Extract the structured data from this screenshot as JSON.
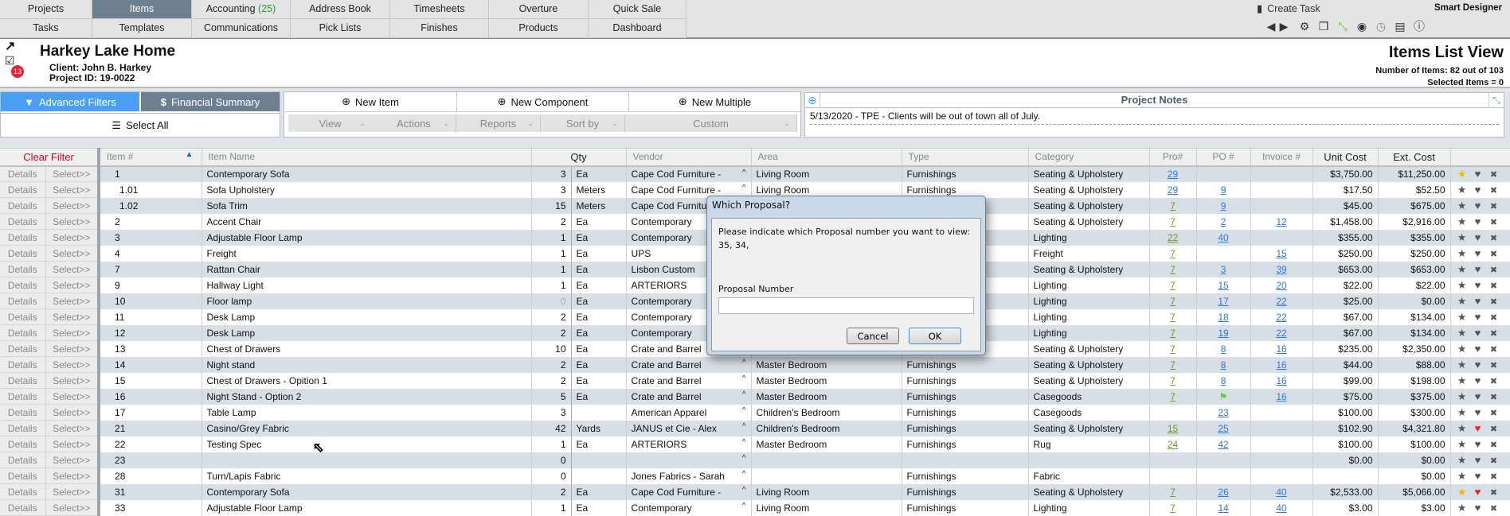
{
  "nav": {
    "row1": [
      {
        "label": "Projects"
      },
      {
        "label": "Items",
        "active": true
      },
      {
        "label": "Accounting",
        "count": "(25)"
      },
      {
        "label": "Address Book"
      },
      {
        "label": "Timesheets"
      },
      {
        "label": "Overture"
      },
      {
        "label": "Quick Sale"
      }
    ],
    "row2": [
      {
        "label": "Tasks"
      },
      {
        "label": "Templates"
      },
      {
        "label": "Communications"
      },
      {
        "label": "Pick Lists"
      },
      {
        "label": "Finishes"
      },
      {
        "label": "Products"
      },
      {
        "label": "Dashboard"
      }
    ],
    "create_task": "Create Task",
    "user": "Smart Designer",
    "toolbar_icons": [
      "arrow-left-icon",
      "arrow-right-icon",
      "gear-icon",
      "windows-icon",
      "expand-icon",
      "user-icon",
      "clock-icon",
      "panel-icon",
      "info-icon"
    ]
  },
  "header": {
    "title": "Harkey Lake Home",
    "client": "Client: John B. Harkey",
    "project_id": "Project ID: 19-0022",
    "task_badge": "13",
    "view_title": "Items List View",
    "num_items": "Number of Items: 82 out of 103",
    "selected": "Selected Items = 0"
  },
  "toolbar": {
    "advanced_filters": "Advanced Filters",
    "financial_summary": "Financial Summary",
    "select_all": "Select All",
    "new_item": "New Item",
    "new_component": "New Component",
    "new_multiple": "New Multiple",
    "dropdowns": [
      "View",
      "Actions",
      "Reports",
      "Sort by",
      "Custom"
    ]
  },
  "notes": {
    "title": "Project Notes",
    "entries": [
      "5/13/2020 - TPE - Clients will be out of town all of July."
    ]
  },
  "table": {
    "clear_filter": "Clear Filter",
    "headers": {
      "item": "Item #",
      "name": "Item Name",
      "qty": "Qty",
      "vendor": "Vendor",
      "area": "Area",
      "type": "Type",
      "category": "Category",
      "pro": "Pro#",
      "po": "PO #",
      "invoice": "Invoice #",
      "unit_cost": "Unit Cost",
      "ext_cost": "Ext. Cost"
    },
    "details_label": "Details",
    "select_label": "Select>>",
    "rows": [
      {
        "item": "1",
        "name": "Contemporary Sofa",
        "qty": "3",
        "unit": "Ea",
        "vendor": "Cape Cod Furniture -",
        "area": "Living Room",
        "type": "Furnishings",
        "category": "Seating & Upholstery",
        "pro": "29",
        "pro_color": "blue",
        "po": "",
        "invoice": "",
        "unit_cost": "$3,750.00",
        "ext_cost": "$11,250.00",
        "star": true,
        "heart": false
      },
      {
        "item": "1.01",
        "name": "Sofa Upholstery",
        "qty": "3",
        "unit": "Meters",
        "vendor": "Cape Cod Furniture -",
        "area": "Living Room",
        "type": "Furnishings",
        "category": "Seating & Upholstery",
        "pro": "29",
        "pro_color": "blue",
        "po": "9",
        "invoice": "",
        "unit_cost": "$17.50",
        "ext_cost": "$52.50"
      },
      {
        "item": "1.02",
        "name": "Sofa Trim",
        "qty": "15",
        "unit": "Meters",
        "vendor": "Cape Cod Furniture -",
        "area": "",
        "type": "",
        "category": "Seating & Upholstery",
        "pro": "7",
        "pro_color": "green",
        "po": "9",
        "invoice": "",
        "unit_cost": "$45.00",
        "ext_cost": "$675.00"
      },
      {
        "item": "2",
        "name": "Accent Chair",
        "qty": "2",
        "unit": "Ea",
        "vendor": "Contemporary",
        "area": "",
        "type": "",
        "category": "Seating & Upholstery",
        "pro": "7",
        "pro_color": "green",
        "po": "2",
        "invoice": "12",
        "unit_cost": "$1,458.00",
        "ext_cost": "$2,916.00"
      },
      {
        "item": "3",
        "name": "Adjustable Floor Lamp",
        "qty": "1",
        "unit": "Ea",
        "vendor": "Contemporary",
        "area": "",
        "type": "",
        "category": "Lighting",
        "pro": "22",
        "pro_color": "green",
        "po": "40",
        "invoice": "",
        "unit_cost": "$355.00",
        "ext_cost": "$355.00"
      },
      {
        "item": "4",
        "name": "Freight",
        "qty": "1",
        "unit": "Ea",
        "vendor": "UPS",
        "area": "",
        "type": "",
        "category": "Freight",
        "pro": "7",
        "pro_color": "green",
        "po": "",
        "invoice": "15",
        "unit_cost": "$250.00",
        "ext_cost": "$250.00"
      },
      {
        "item": "7",
        "name": "Rattan Chair",
        "qty": "1",
        "unit": "Ea",
        "vendor": "Lisbon Custom",
        "area": "",
        "type": "",
        "category": "Seating & Upholstery",
        "pro": "7",
        "pro_color": "green",
        "po": "3",
        "invoice": "39",
        "unit_cost": "$653.00",
        "ext_cost": "$653.00"
      },
      {
        "item": "9",
        "name": "Hallway Light",
        "qty": "1",
        "unit": "Ea",
        "vendor": "ARTERIORS",
        "area": "",
        "type": "",
        "category": "Lighting",
        "pro": "7",
        "pro_color": "green",
        "po": "15",
        "invoice": "20",
        "unit_cost": "$22.00",
        "ext_cost": "$22.00"
      },
      {
        "item": "10",
        "name": "Floor lamp",
        "qty": "0",
        "qty_muted": true,
        "unit": "Ea",
        "vendor": "Contemporary",
        "area": "",
        "type": "",
        "category": "Lighting",
        "pro": "7",
        "pro_color": "green",
        "po": "17",
        "invoice": "22",
        "unit_cost": "$25.00",
        "ext_cost": "$0.00"
      },
      {
        "item": "11",
        "name": "Desk Lamp",
        "qty": "2",
        "unit": "Ea",
        "vendor": "Contemporary",
        "area": "",
        "type": "",
        "category": "Lighting",
        "pro": "7",
        "pro_color": "green",
        "po": "18",
        "invoice": "22",
        "unit_cost": "$67.00",
        "ext_cost": "$134.00"
      },
      {
        "item": "12",
        "name": "Desk Lamp",
        "qty": "2",
        "unit": "Ea",
        "vendor": "Contemporary",
        "area": "",
        "type": "",
        "category": "Lighting",
        "pro": "7",
        "pro_color": "green",
        "po": "19",
        "invoice": "22",
        "unit_cost": "$67.00",
        "ext_cost": "$134.00"
      },
      {
        "item": "13",
        "name": "Chest of Drawers",
        "qty": "10",
        "unit": "Ea",
        "vendor": "Crate and Barrel",
        "area": "",
        "type": "",
        "category": "Seating & Upholstery",
        "pro": "7",
        "pro_color": "green",
        "po": "8",
        "invoice": "16",
        "unit_cost": "$235.00",
        "ext_cost": "$2,350.00"
      },
      {
        "item": "14",
        "name": "Night stand",
        "qty": "2",
        "unit": "Ea",
        "vendor": "Crate and Barrel",
        "area": "Master Bedroom",
        "type": "Furnishings",
        "category": "Seating & Upholstery",
        "pro": "7",
        "pro_color": "green",
        "po": "8",
        "invoice": "16",
        "unit_cost": "$44.00",
        "ext_cost": "$88.00"
      },
      {
        "item": "15",
        "name": "Chest of Drawers - Opition 1",
        "qty": "2",
        "unit": "Ea",
        "vendor": "Crate and Barrel",
        "area": "Master Bedroom",
        "type": "Furnishings",
        "category": "Seating & Upholstery",
        "pro": "7",
        "pro_color": "green",
        "po": "8",
        "invoice": "16",
        "unit_cost": "$99.00",
        "ext_cost": "$198.00"
      },
      {
        "item": "16",
        "name": "Night Stand - Option 2",
        "qty": "5",
        "unit": "Ea",
        "vendor": "Crate and Barrel",
        "area": "Master Bedroom",
        "type": "Furnishings",
        "category": "Casegoods",
        "pro": "7",
        "pro_color": "green",
        "po": "",
        "po_flag": true,
        "invoice": "16",
        "unit_cost": "$75.00",
        "ext_cost": "$375.00"
      },
      {
        "item": "17",
        "name": "Table Lamp",
        "qty": "3",
        "unit": "",
        "vendor": "American Apparel",
        "area": "Children's Bedroom",
        "type": "Furnishings",
        "category": "Casegoods",
        "pro": "",
        "po": "23",
        "invoice": "",
        "unit_cost": "$100.00",
        "ext_cost": "$300.00"
      },
      {
        "item": "21",
        "name": "Casino/Grey Fabric",
        "qty": "42",
        "unit": "Yards",
        "vendor": "JANUS et Cie - Alex",
        "area": "Children's Bedroom",
        "type": "Furnishings",
        "category": "Seating & Upholstery",
        "pro": "15",
        "pro_color": "green",
        "po": "25",
        "invoice": "",
        "unit_cost": "$102.90",
        "ext_cost": "$4,321.80",
        "heart": true
      },
      {
        "item": "22",
        "name": "Testing Spec",
        "qty": "1",
        "unit": "Ea",
        "vendor": "ARTERIORS",
        "area": "Master Bedroom",
        "type": "Furnishings",
        "category": "Rug",
        "pro": "24",
        "pro_color": "green",
        "po": "42",
        "invoice": "",
        "unit_cost": "$100.00",
        "ext_cost": "$100.00"
      },
      {
        "item": "23",
        "name": "",
        "qty": "0",
        "unit": "",
        "vendor": "",
        "area": "",
        "type": "",
        "category": "",
        "pro": "",
        "po": "",
        "invoice": "",
        "unit_cost": "$0.00",
        "ext_cost": "$0.00"
      },
      {
        "item": "28",
        "name": "Turn/Lapis Fabric",
        "qty": "0",
        "unit": "",
        "vendor": "Jones Fabrics - Sarah",
        "area": "",
        "type": "Furnishings",
        "category": "Fabric",
        "pro": "",
        "po": "",
        "invoice": "",
        "unit_cost": "",
        "ext_cost": "$0.00"
      },
      {
        "item": "31",
        "name": "Contemporary Sofa",
        "qty": "2",
        "unit": "Ea",
        "vendor": "Cape Cod Furniture -",
        "area": "Living Room",
        "type": "Furnishings",
        "category": "Seating & Upholstery",
        "pro": "7",
        "pro_color": "green",
        "po": "26",
        "invoice": "40",
        "unit_cost": "$2,533.00",
        "ext_cost": "$5,066.00",
        "star": true,
        "heart": true
      },
      {
        "item": "33",
        "name": "Adjustable Floor Lamp",
        "qty": "1",
        "unit": "Ea",
        "vendor": "Contemporary",
        "area": "Living Room",
        "type": "Furnishings",
        "category": "Lighting",
        "pro": "7",
        "pro_color": "green",
        "po": "14",
        "invoice": "40",
        "unit_cost": "$3.00",
        "ext_cost": "$3.00"
      }
    ]
  },
  "dialog": {
    "title": "Which Proposal?",
    "message": "Please indicate which  Proposal  number you want to view:",
    "options": "35, 34,",
    "field_label": "Proposal Number",
    "field_value": "",
    "cancel": "Cancel",
    "ok": "OK"
  },
  "colors": {
    "active_tab": "#6e7f8f",
    "advanced_filters": "#4a9ff5",
    "row_stripe": "#d8dee6",
    "link_green": "#6a9a1f",
    "link_blue": "#2a7ae2",
    "star_gold": "#f5b400",
    "heart_red": "#e8281e",
    "badge_red": "#e8203a"
  }
}
